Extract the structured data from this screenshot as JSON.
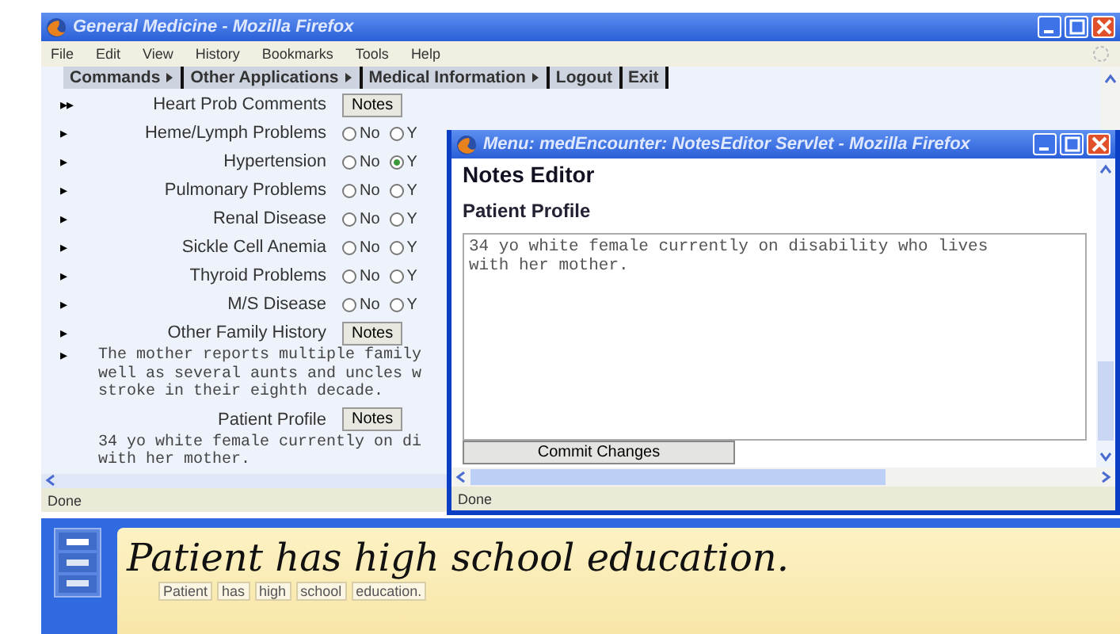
{
  "main_window": {
    "title": "General Medicine - Mozilla Firefox",
    "menu": [
      "File",
      "Edit",
      "View",
      "History",
      "Bookmarks",
      "Tools",
      "Help"
    ],
    "commands": [
      {
        "label": "Commands",
        "submenu": true
      },
      {
        "label": "Other Applications",
        "submenu": true
      },
      {
        "label": "Medical Information",
        "submenu": true
      },
      {
        "label": "Logout",
        "submenu": false
      },
      {
        "label": "Exit",
        "submenu": false
      }
    ],
    "rows": [
      {
        "kind": "notes",
        "marker": "▸▸",
        "label": "Heart Prob Comments",
        "button": "Notes"
      },
      {
        "kind": "radio",
        "marker": "▸",
        "label": "Heme/Lymph Problems",
        "options": [
          {
            "label": "No",
            "selected": false
          },
          {
            "label": "Y",
            "selected": false
          }
        ]
      },
      {
        "kind": "radio",
        "marker": "▸",
        "label": "Hypertension",
        "options": [
          {
            "label": "No",
            "selected": false
          },
          {
            "label": "Y",
            "selected": true
          }
        ]
      },
      {
        "kind": "radio",
        "marker": "▸",
        "label": "Pulmonary Problems",
        "options": [
          {
            "label": "No",
            "selected": false
          },
          {
            "label": "Y",
            "selected": false
          }
        ]
      },
      {
        "kind": "radio",
        "marker": "▸",
        "label": "Renal Disease",
        "options": [
          {
            "label": "No",
            "selected": false
          },
          {
            "label": "Y",
            "selected": false
          }
        ]
      },
      {
        "kind": "radio",
        "marker": "▸",
        "label": "Sickle Cell Anemia",
        "options": [
          {
            "label": "No",
            "selected": false
          },
          {
            "label": "Y",
            "selected": false
          }
        ]
      },
      {
        "kind": "radio",
        "marker": "▸",
        "label": "Thyroid Problems",
        "options": [
          {
            "label": "No",
            "selected": false
          },
          {
            "label": "Y",
            "selected": false
          }
        ]
      },
      {
        "kind": "radio",
        "marker": "▸",
        "label": "M/S Disease",
        "options": [
          {
            "label": "No",
            "selected": false
          },
          {
            "label": "Y",
            "selected": false
          }
        ]
      },
      {
        "kind": "notes",
        "marker": "▸",
        "label": "Other Family History",
        "button": "Notes"
      },
      {
        "kind": "text",
        "marker": "▸",
        "lines": [
          "The mother reports multiple family",
          "well as several aunts and uncles w",
          "stroke in their eighth decade."
        ]
      },
      {
        "kind": "notes",
        "label": "Patient Profile",
        "button": "Notes"
      },
      {
        "kind": "text",
        "lines": [
          "34 yo white female currently on di",
          "with her mother."
        ]
      }
    ],
    "status": "Done"
  },
  "editor_window": {
    "title": "Menu: medEncounter: NotesEditor Servlet - Mozilla Firefox",
    "heading": "Notes Editor",
    "subheading": "Patient Profile",
    "text": "34 yo white female currently on disability who lives\nwith her mother.",
    "button": "Commit Changes",
    "status": "Done"
  },
  "input_panel": {
    "ink": "Patient has high school education.",
    "words": [
      "Patient",
      "has",
      "high",
      "school",
      "education."
    ]
  }
}
